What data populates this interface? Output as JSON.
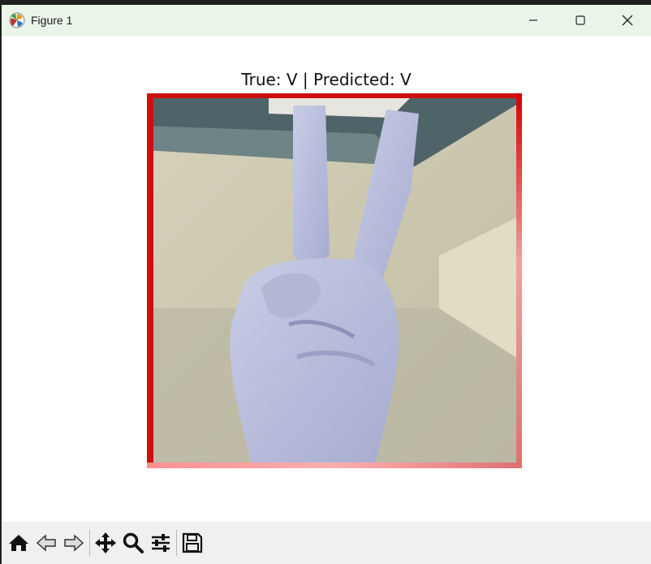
{
  "window": {
    "title": "Figure 1",
    "icons": {
      "app": "matplotlib-icon",
      "minimize": "minimize-icon",
      "maximize": "maximize-icon",
      "close": "close-icon"
    }
  },
  "figure": {
    "title": "True: V | Predicted: V",
    "image_description_icon": "hand-sign-image"
  },
  "toolbar": {
    "buttons": [
      "home-icon",
      "back-icon",
      "forward-icon",
      "pan-icon",
      "zoom-icon",
      "configure-icon",
      "save-icon"
    ]
  }
}
